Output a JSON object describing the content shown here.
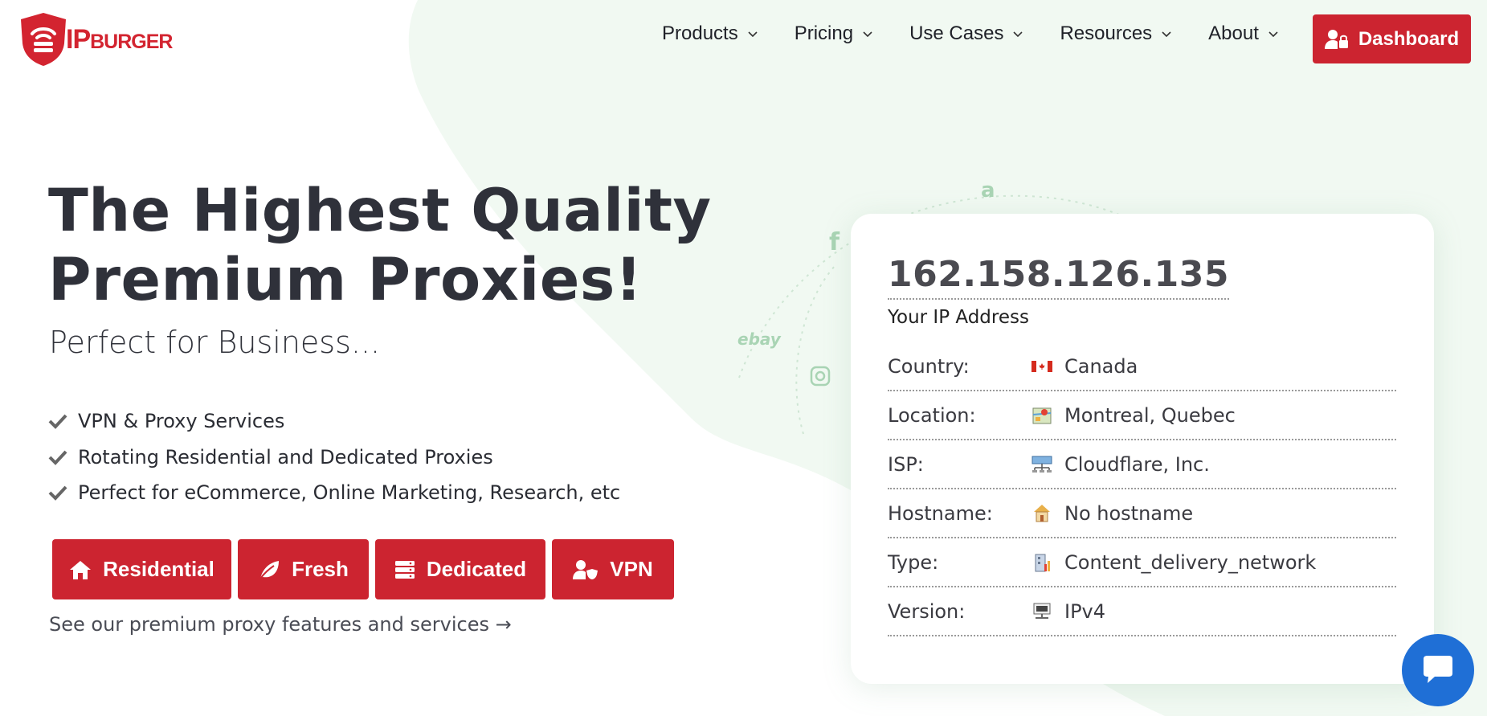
{
  "brand": {
    "logo_big": "IP",
    "logo_small": "BURGER"
  },
  "nav": {
    "items": [
      {
        "label": "Products"
      },
      {
        "label": "Pricing"
      },
      {
        "label": "Use Cases"
      },
      {
        "label": "Resources"
      },
      {
        "label": "About"
      }
    ],
    "dashboard_label": "Dashboard"
  },
  "hero": {
    "title_line1": "The Highest Quality",
    "title_line2": "Premium Proxies!",
    "subtitle": "Perfect for Business...",
    "features": [
      "VPN & Proxy Services",
      "Rotating Residential and Dedicated Proxies",
      "Perfect for eCommerce, Online Marketing, Research, etc"
    ],
    "buttons": {
      "residential": "Residential",
      "fresh": "Fresh",
      "dedicated": "Dedicated",
      "vpn": "VPN"
    },
    "link_text": "See our premium proxy features and services →"
  },
  "ip_card": {
    "ip": "162.158.126.135",
    "caption": "Your IP Address",
    "rows": [
      {
        "label": "Country:",
        "value": "Canada",
        "icon": "canada-flag-icon"
      },
      {
        "label": "Location:",
        "value": "Montreal, Quebec",
        "icon": "map-icon"
      },
      {
        "label": "ISP:",
        "value": "Cloudflare, Inc.",
        "icon": "network-icon"
      },
      {
        "label": "Hostname:",
        "value": "No hostname",
        "icon": "host-icon"
      },
      {
        "label": "Type:",
        "value": "Content_delivery_network",
        "icon": "building-icon"
      },
      {
        "label": "Version:",
        "value": "IPv4",
        "icon": "ipv4-icon"
      }
    ]
  },
  "background_marks": {
    "amazon": "a",
    "facebook": "f",
    "ebay": "ebay"
  },
  "colors": {
    "brand_red": "#cc2430",
    "chat_blue": "#1f6fd6",
    "blob_green": "#f1f9f2"
  }
}
